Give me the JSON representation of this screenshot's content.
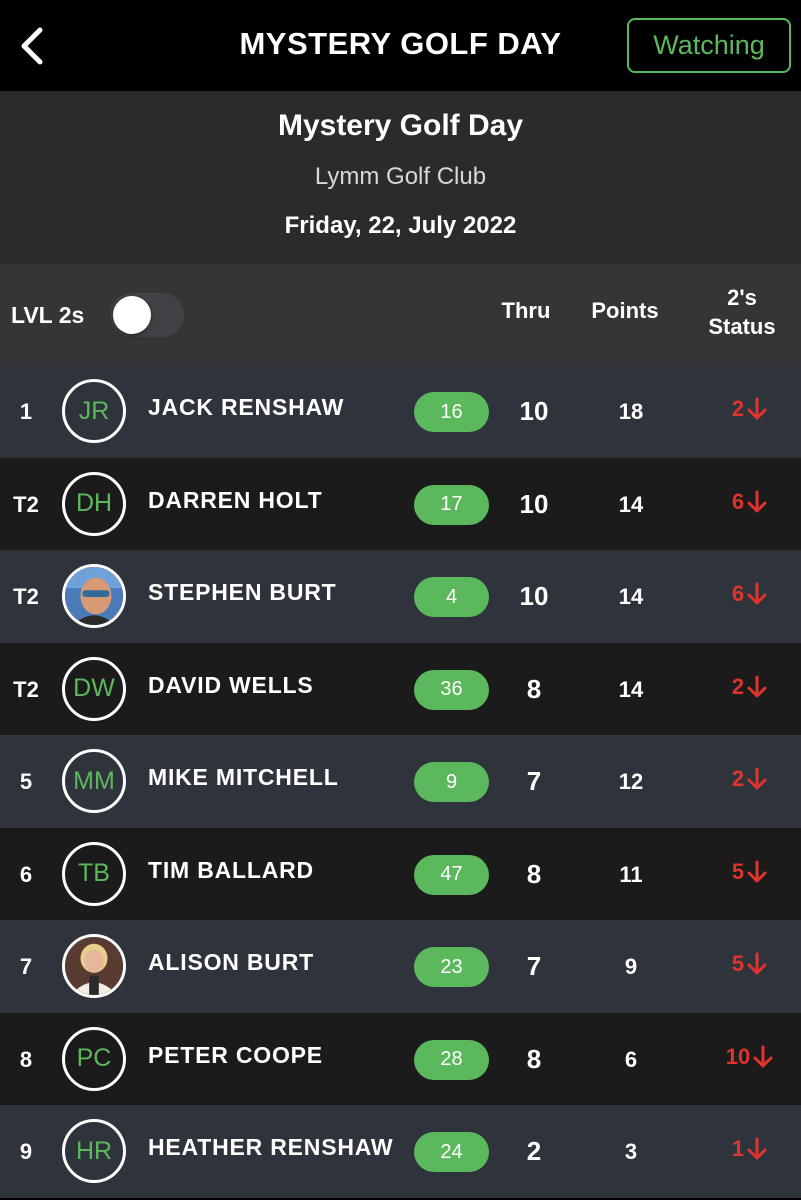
{
  "nav": {
    "title": "MYSTERY GOLF DAY",
    "watching_label": "Watching",
    "back_icon": "chevron-left-icon"
  },
  "event": {
    "name": "Mystery Golf Day",
    "venue": "Lymm Golf Club",
    "date": "Friday, 22, July 2022"
  },
  "columns": {
    "lvl_label": "LVL 2s",
    "lvl_toggle_on": false,
    "thru": "Thru",
    "points": "Points",
    "status_line1": "2's",
    "status_line2": "Status"
  },
  "colors": {
    "accent_green": "#5cb85c",
    "status_red": "#e0332d"
  },
  "players": [
    {
      "pos": "1",
      "initials": "JR",
      "photo": false,
      "name": "JACK RENSHAW",
      "hcp": "16",
      "thru": "10",
      "points": "18",
      "status": "2",
      "status_icon": "arrow-down-icon"
    },
    {
      "pos": "T2",
      "initials": "DH",
      "photo": false,
      "name": "DARREN HOLT",
      "hcp": "17",
      "thru": "10",
      "points": "14",
      "status": "6",
      "status_icon": "arrow-down-icon"
    },
    {
      "pos": "T2",
      "initials": "",
      "photo": true,
      "name": "STEPHEN BURT",
      "hcp": "4",
      "thru": "10",
      "points": "14",
      "status": "6",
      "status_icon": "arrow-down-icon"
    },
    {
      "pos": "T2",
      "initials": "DW",
      "photo": false,
      "name": "DAVID WELLS",
      "hcp": "36",
      "thru": "8",
      "points": "14",
      "status": "2",
      "status_icon": "arrow-down-icon"
    },
    {
      "pos": "5",
      "initials": "MM",
      "photo": false,
      "name": "MIKE MITCHELL",
      "hcp": "9",
      "thru": "7",
      "points": "12",
      "status": "2",
      "status_icon": "arrow-down-icon"
    },
    {
      "pos": "6",
      "initials": "TB",
      "photo": false,
      "name": "TIM BALLARD",
      "hcp": "47",
      "thru": "8",
      "points": "11",
      "status": "5",
      "status_icon": "arrow-down-icon"
    },
    {
      "pos": "7",
      "initials": "",
      "photo": true,
      "name": "ALISON BURT",
      "hcp": "23",
      "thru": "7",
      "points": "9",
      "status": "5",
      "status_icon": "arrow-down-icon"
    },
    {
      "pos": "8",
      "initials": "PC",
      "photo": false,
      "name": "PETER COOPE",
      "hcp": "28",
      "thru": "8",
      "points": "6",
      "status": "10",
      "status_icon": "arrow-down-icon"
    },
    {
      "pos": "9",
      "initials": "HR",
      "photo": false,
      "name": "HEATHER RENSHAW",
      "hcp": "24",
      "thru": "2",
      "points": "3",
      "status": "1",
      "status_icon": "arrow-down-icon"
    }
  ]
}
